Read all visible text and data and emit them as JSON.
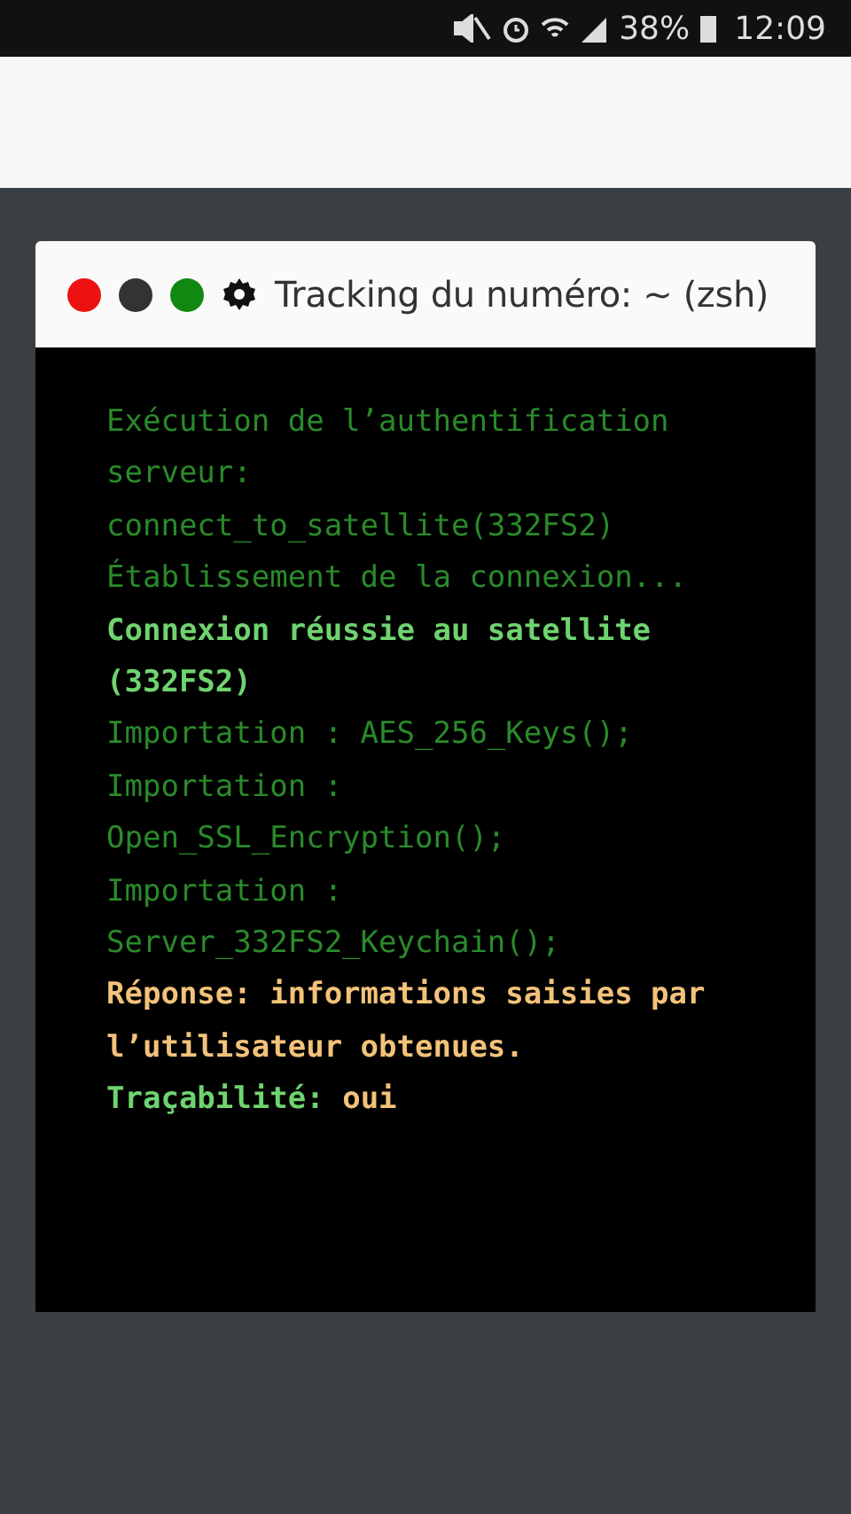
{
  "status_bar": {
    "battery": "38%",
    "time": "12:09"
  },
  "window": {
    "title": "Tracking du numéro: ~ (zsh)",
    "buttons": [
      {
        "color": "#ee1111"
      },
      {
        "color": "#333333"
      },
      {
        "color": "#118811"
      }
    ]
  },
  "terminal": {
    "lines": [
      {
        "kind": "dim",
        "text": "Exécution de l’authentification serveur:"
      },
      {
        "kind": "dim",
        "text": "connect_to_satellite(332FS2)"
      },
      {
        "kind": "dim",
        "text": "Établissement de la connexion..."
      },
      {
        "kind": "success",
        "text": "Connexion réussie au satellite (332FS2)"
      },
      {
        "kind": "dim",
        "text": "Importation : AES_256_Keys();"
      },
      {
        "kind": "dim",
        "text": "Importation : Open_SSL_Encryption();"
      },
      {
        "kind": "dim",
        "text": "Importation : Server_332FS2_Keychain();"
      },
      {
        "kind": "answer",
        "text": "Réponse: informations saisies par l’utilisateur obtenues."
      },
      {
        "kind": "result",
        "label": "Traçabilité:",
        "value": "oui"
      }
    ]
  }
}
